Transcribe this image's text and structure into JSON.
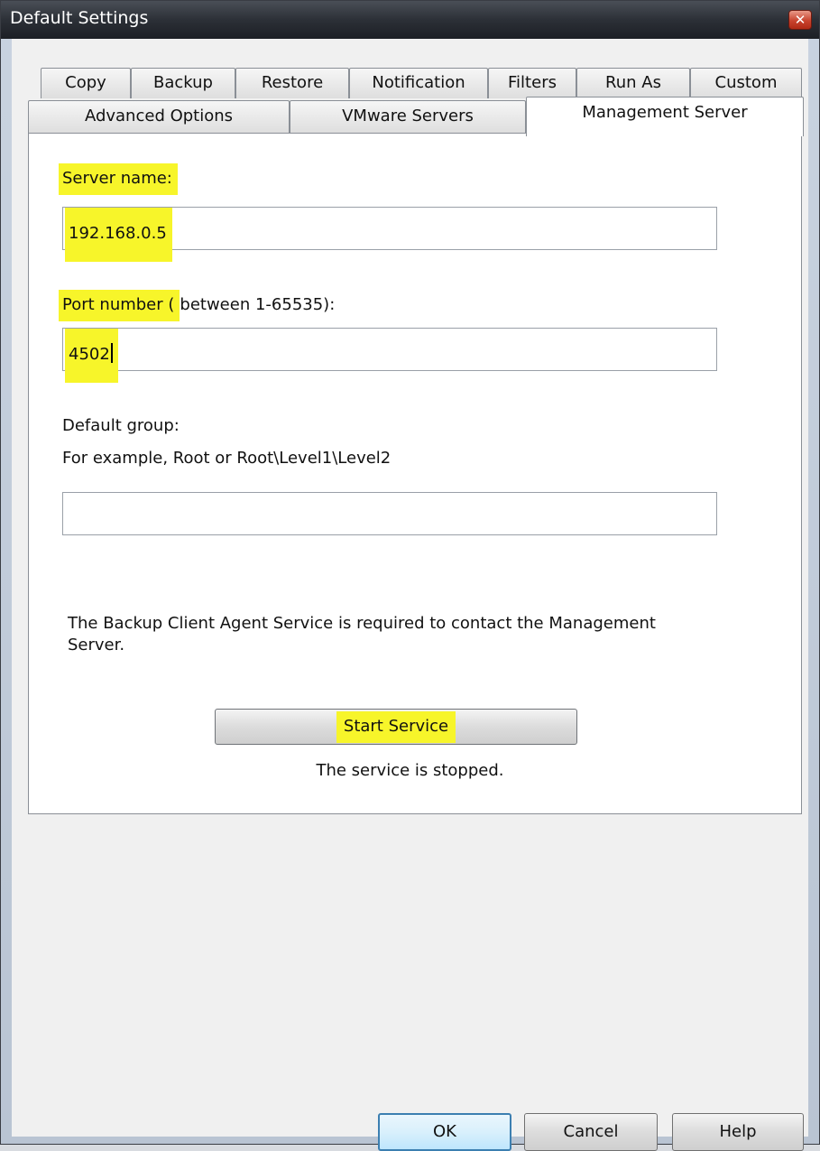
{
  "window": {
    "title": "Default Settings"
  },
  "tabs": {
    "row1": [
      "Copy",
      "Backup",
      "Restore",
      "Notification",
      "Filters",
      "Run As",
      "Custom"
    ],
    "row2": [
      "Advanced Options",
      "VMware Servers",
      "Management Server"
    ],
    "active": "Management Server"
  },
  "form": {
    "server_label": "Server name:",
    "server_value": "192.168.0.5",
    "port_label_highlight": "Port number (",
    "port_label_rest": "between 1-65535):",
    "port_value": "4502",
    "group_label": "Default group:",
    "group_example": "For example, Root or Root\\Level1\\Level2",
    "group_value": ""
  },
  "service": {
    "info_text": "The Backup Client Agent Service is required to contact the Management Server.",
    "start_button": "Start Service",
    "status_text": "The service is stopped."
  },
  "buttons": {
    "ok": "OK",
    "cancel": "Cancel",
    "help": "Help"
  },
  "icons": {
    "close": "close-icon"
  },
  "colors": {
    "highlight": "#f7f52a",
    "default_button_border": "#3c7fb1"
  }
}
